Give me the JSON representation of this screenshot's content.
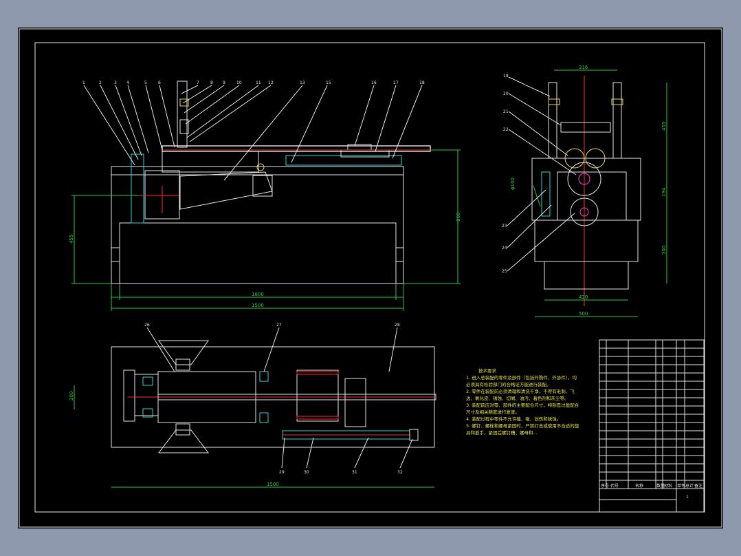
{
  "side_view": {
    "part_numbers": [
      "1",
      "2",
      "3",
      "4",
      "5",
      "6",
      "7",
      "8",
      "9",
      "10",
      "11",
      "12",
      "13",
      "14",
      "15",
      "16",
      "17",
      "18"
    ],
    "dims": {
      "total_length": "1500",
      "body_length": "1800",
      "height": "860",
      "lower_height": "455"
    }
  },
  "end_view": {
    "part_numbers": [
      "19",
      "20",
      "21",
      "22",
      "23",
      "24",
      "25"
    ],
    "dims": {
      "top_width": "316",
      "column_height": "455",
      "mid": "194",
      "lower": "300",
      "width": "420",
      "overall_width": "500",
      "gear_dim": "φ100"
    }
  },
  "top_view": {
    "part_numbers": [
      "26",
      "27",
      "28",
      "29",
      "30",
      "31",
      "32"
    ],
    "dims": {
      "overall_length": "1500",
      "roll_width": "200"
    }
  },
  "notes": {
    "title": "技术要求",
    "items": [
      "1. 进入总装配的零件及部件（包括外购件、外协件），均必须具有检验部门的合格证方能进行装配。",
      "2. 零件在装配前必须清理和清洗干净，不得有毛刺、飞边、氧化皮、锈蚀、切屑、油污、着色剂和灰尘等。",
      "3. 装配前应对零、部件的主要配合尺寸，特别是过盈配合尺寸及相关精度进行复查。",
      "4. 装配过程中零件不允许磕、碰、划伤和锈蚀。",
      "5. 螺钉、螺栓和螺母紧固时，严禁打击或使用不合适的旋具和扳手，紧固后螺钉槽、螺母和..."
    ]
  },
  "title_block": {
    "headers": [
      "序号",
      "代号",
      "名称",
      "数量",
      "材料",
      "单件",
      "总计",
      "备注"
    ],
    "sheet_number": "1"
  }
}
